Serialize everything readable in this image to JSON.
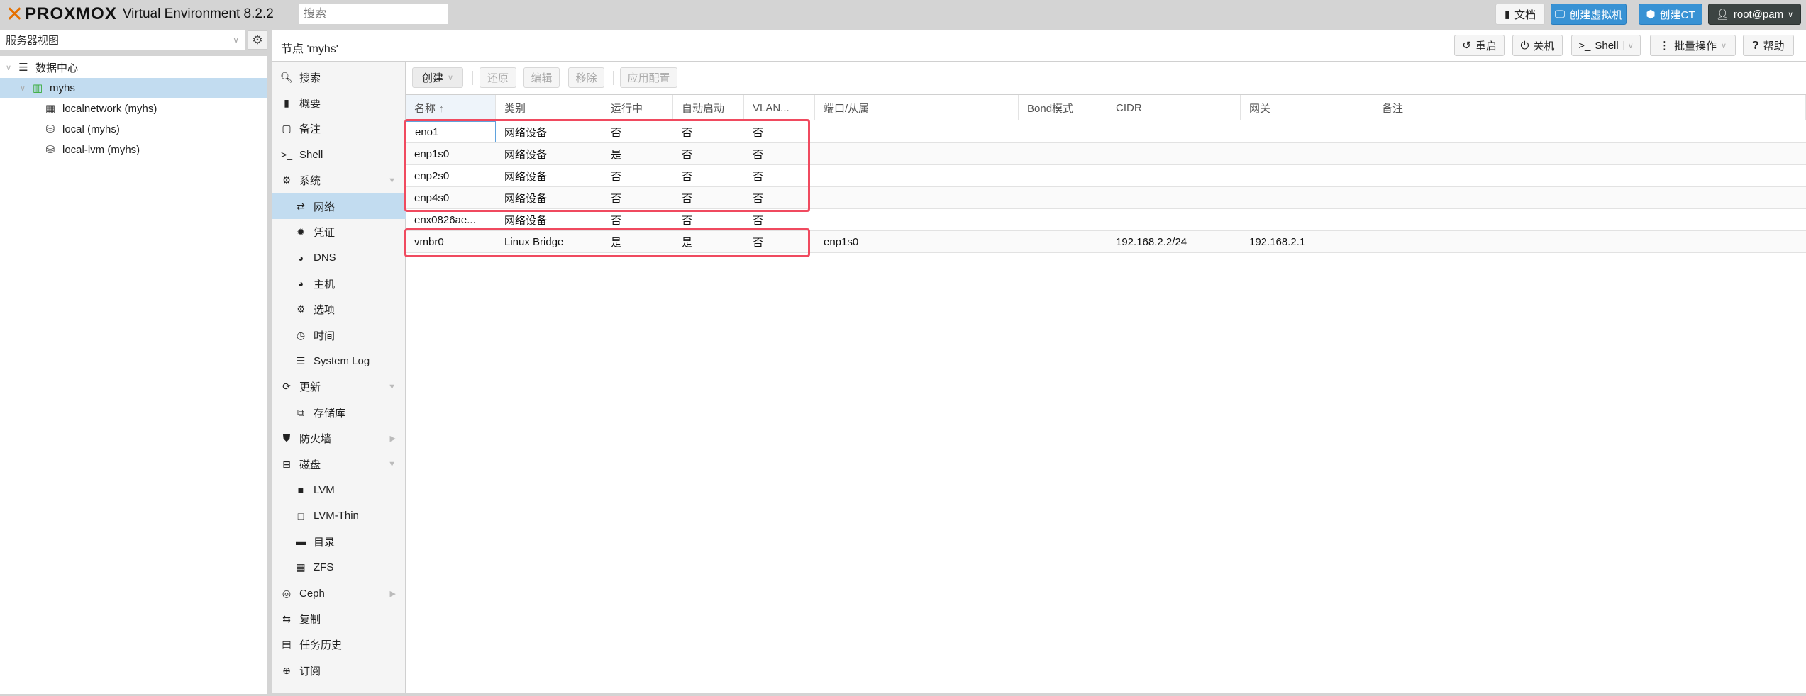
{
  "app": {
    "logo_text": "PROXMOX",
    "title": "Virtual Environment 8.2.2",
    "search_placeholder": "搜索"
  },
  "topbar": {
    "docs": "文档",
    "create_vm": "创建虚拟机",
    "create_ct": "创建CT",
    "user": "root@pam"
  },
  "colors": {
    "accent": "#3892d4",
    "brand": "#e57000",
    "selected": "#c2dcf0",
    "highlight": "#f04a5f"
  },
  "sidebar": {
    "view_select": "服务器视图",
    "tree": [
      {
        "label": "数据中心",
        "icon": "datacenter-icon"
      },
      {
        "label": "myhs",
        "icon": "node-online-icon",
        "selected": true
      },
      {
        "label": "localnetwork (myhs)",
        "icon": "sdn-grid-icon"
      },
      {
        "label": "local (myhs)",
        "icon": "storage-icon"
      },
      {
        "label": "local-lvm (myhs)",
        "icon": "storage-icon"
      }
    ]
  },
  "header": {
    "title": "节点 'myhs'",
    "reboot": "重启",
    "shutdown": "关机",
    "shell": "Shell",
    "bulk": "批量操作",
    "help": "帮助"
  },
  "nav": [
    {
      "label": "搜索",
      "icon": "search-icon",
      "glyph": "🔍︎"
    },
    {
      "label": "概要",
      "icon": "book-icon",
      "glyph": "▮"
    },
    {
      "label": "备注",
      "icon": "notes-icon",
      "glyph": "▢"
    },
    {
      "label": "Shell",
      "icon": "terminal-icon",
      "glyph": ">_"
    },
    {
      "label": "系统",
      "icon": "cogs-icon",
      "glyph": "⚙",
      "arrow": "▼"
    },
    {
      "label": "网络",
      "icon": "exchange-icon",
      "glyph": "⇄",
      "sub": true,
      "selected": true
    },
    {
      "label": "凭证",
      "icon": "certificate-icon",
      "glyph": "✹",
      "sub": true
    },
    {
      "label": "DNS",
      "icon": "globe-icon",
      "glyph": "◕",
      "sub": true
    },
    {
      "label": "主机",
      "icon": "globe-icon",
      "glyph": "◕",
      "sub": true
    },
    {
      "label": "选项",
      "icon": "gear-icon",
      "glyph": "⚙",
      "sub": true
    },
    {
      "label": "时间",
      "icon": "clock-icon",
      "glyph": "◷",
      "sub": true
    },
    {
      "label": "System Log",
      "icon": "list-icon",
      "glyph": "☰",
      "sub": true
    },
    {
      "label": "更新",
      "icon": "refresh-icon",
      "glyph": "⟳",
      "arrow": "▼"
    },
    {
      "label": "存储库",
      "icon": "files-icon",
      "glyph": "⧉",
      "sub": true
    },
    {
      "label": "防火墙",
      "icon": "shield-icon",
      "glyph": "⛊",
      "arrow": "▶"
    },
    {
      "label": "磁盘",
      "icon": "hdd-icon",
      "glyph": "⊟",
      "arrow": "▼"
    },
    {
      "label": "LVM",
      "icon": "square-icon",
      "glyph": "■",
      "sub": true
    },
    {
      "label": "LVM-Thin",
      "icon": "square-outline-icon",
      "glyph": "□",
      "sub": true
    },
    {
      "label": "目录",
      "icon": "folder-icon",
      "glyph": "▬",
      "sub": true
    },
    {
      "label": "ZFS",
      "icon": "th-large-icon",
      "glyph": "▦",
      "sub": true
    },
    {
      "label": "Ceph",
      "icon": "ceph-icon",
      "glyph": "◎",
      "arrow": "▶"
    },
    {
      "label": "复制",
      "icon": "retweet-icon",
      "glyph": "⇆"
    },
    {
      "label": "任务历史",
      "icon": "tasks-icon",
      "glyph": "▤"
    },
    {
      "label": "订阅",
      "icon": "support-icon",
      "glyph": "⊕"
    }
  ],
  "toolbar": {
    "create": "创建",
    "revert": "还原",
    "edit": "编辑",
    "remove": "移除",
    "apply": "应用配置"
  },
  "table": {
    "columns": [
      "名称 ↑",
      "类别",
      "运行中",
      "自动启动",
      "VLAN...",
      "端口/从属",
      "Bond模式",
      "CIDR",
      "网关",
      "备注"
    ],
    "rows": [
      [
        "eno1",
        "网络设备",
        "否",
        "否",
        "否",
        "",
        "",
        "",
        "",
        ""
      ],
      [
        "enp1s0",
        "网络设备",
        "是",
        "否",
        "否",
        "",
        "",
        "",
        "",
        ""
      ],
      [
        "enp2s0",
        "网络设备",
        "否",
        "否",
        "否",
        "",
        "",
        "",
        "",
        ""
      ],
      [
        "enp4s0",
        "网络设备",
        "否",
        "否",
        "否",
        "",
        "",
        "",
        "",
        ""
      ],
      [
        "enx0826ae...",
        "网络设备",
        "否",
        "否",
        "否",
        "",
        "",
        "",
        "",
        ""
      ],
      [
        "vmbr0",
        "Linux Bridge",
        "是",
        "是",
        "否",
        "enp1s0",
        "",
        "192.168.2.2/24",
        "192.168.2.1",
        ""
      ]
    ]
  }
}
